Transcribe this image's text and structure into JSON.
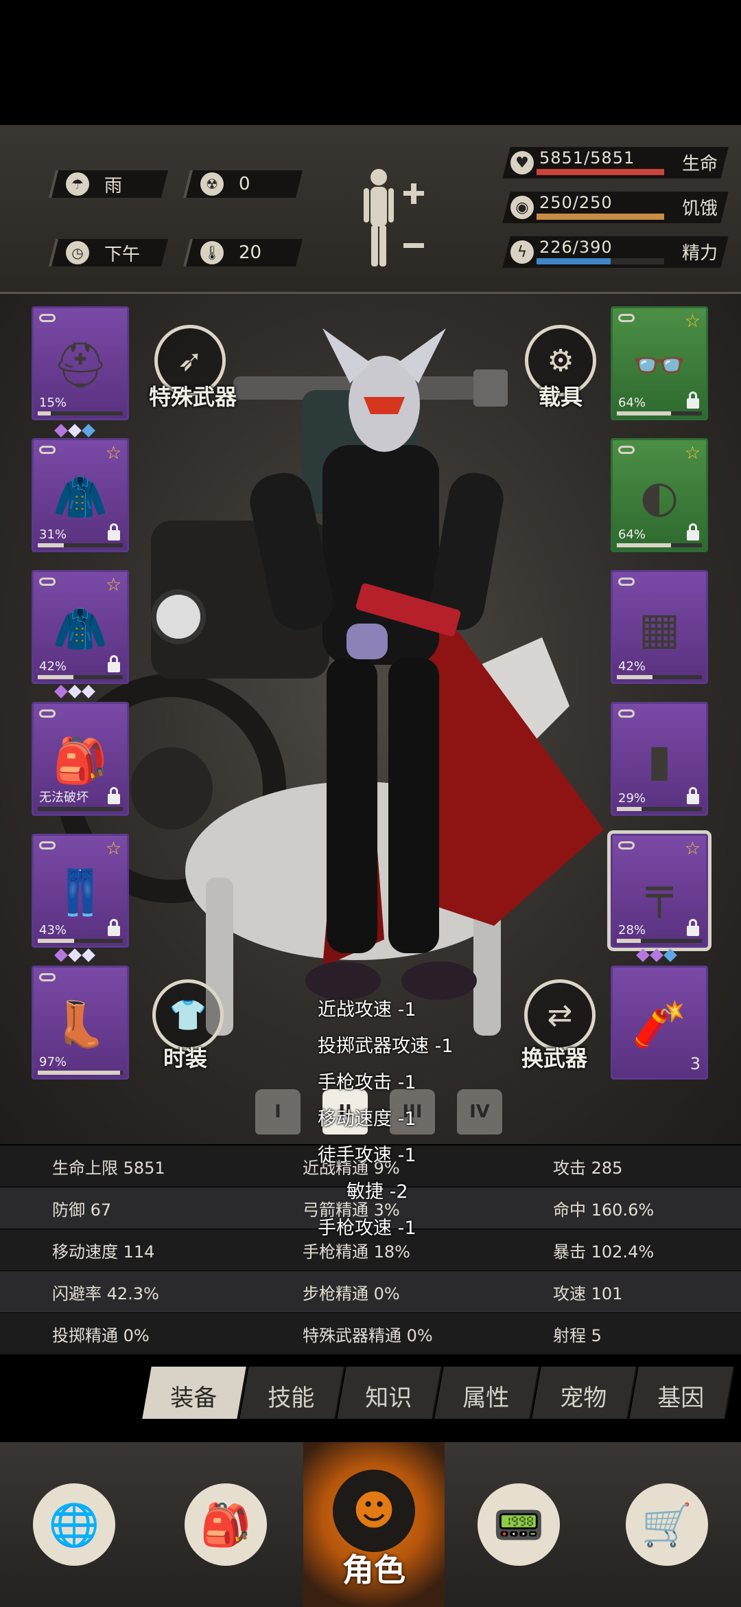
{
  "env": {
    "weather": "雨",
    "radiation": "0",
    "time_of_day": "下午",
    "temperature": "20"
  },
  "vitals": [
    {
      "value": "5851/5851",
      "label": "生命",
      "fraction": 1.0,
      "color": "#c9443a",
      "icon": "heart-icon"
    },
    {
      "value": "250/250",
      "label": "饥饿",
      "fraction": 1.0,
      "color": "#c98c45",
      "icon": "stomach-icon"
    },
    {
      "value": "226/390",
      "label": "精力",
      "fraction": 0.58,
      "color": "#3f86c9",
      "icon": "energy-icon"
    }
  ],
  "buttons": {
    "special_weapon": "特殊武器",
    "vehicle": "载具",
    "fashion": "时装",
    "switch_weapon": "换武器"
  },
  "left_slots": [
    {
      "name": "helmet",
      "pct": "15%",
      "dur": 0.15,
      "star": false,
      "lock": false
    },
    {
      "name": "jacket",
      "pct": "31%",
      "dur": 0.31,
      "star": true,
      "lock": true
    },
    {
      "name": "coat",
      "pct": "42%",
      "dur": 0.42,
      "star": true,
      "lock": true
    },
    {
      "name": "backpack",
      "pct": "无法破坏",
      "dur": 0,
      "star": false,
      "lock": true
    },
    {
      "name": "pants",
      "pct": "43%",
      "dur": 0.43,
      "star": true,
      "lock": true
    },
    {
      "name": "boots",
      "pct": "97%",
      "dur": 0.97,
      "star": false,
      "lock": false
    }
  ],
  "right_slots": [
    {
      "name": "glasses",
      "pct": "64%",
      "dur": 0.64,
      "star": true,
      "lock": true
    },
    {
      "name": "mask",
      "pct": "64%",
      "dur": 0.64,
      "star": true,
      "lock": true
    },
    {
      "name": "vest",
      "pct": "42%",
      "dur": 0.42,
      "star": false,
      "lock": false
    },
    {
      "name": "shield",
      "pct": "29%",
      "dur": 0.29,
      "star": false,
      "lock": true
    },
    {
      "name": "pistol",
      "pct": "28%",
      "dur": 0.28,
      "star": true,
      "lock": true
    },
    {
      "name": "dynamite",
      "count": "3"
    }
  ],
  "outfit_tabs": [
    "I",
    "II",
    "III",
    "IV"
  ],
  "debuffs": [
    "近战攻速 -1",
    "投掷武器攻速 -1",
    "手枪攻击 -1",
    "移动速度 -1",
    "徒手攻速 -1",
    "敏捷 -2",
    "手枪攻速 -1"
  ],
  "stats": [
    [
      "生命上限 5851",
      "近战精通 9%",
      "攻击 285"
    ],
    [
      "防御 67",
      "弓箭精通 3%",
      "命中 160.6%"
    ],
    [
      "移动速度 114",
      "手枪精通 18%",
      "暴击 102.4%"
    ],
    [
      "闪避率 42.3%",
      "步枪精通 0%",
      "攻速 101"
    ],
    [
      "投掷精通 0%",
      "特殊武器精通 0%",
      "射程 5"
    ]
  ],
  "tabs": [
    "装备",
    "技能",
    "知识",
    "属性",
    "宠物",
    "基因"
  ],
  "nav": {
    "active_label": "角色",
    "items": [
      "map-globe-icon",
      "backpack-icon",
      "character-icon",
      "radio-icon",
      "cart-icon"
    ]
  }
}
